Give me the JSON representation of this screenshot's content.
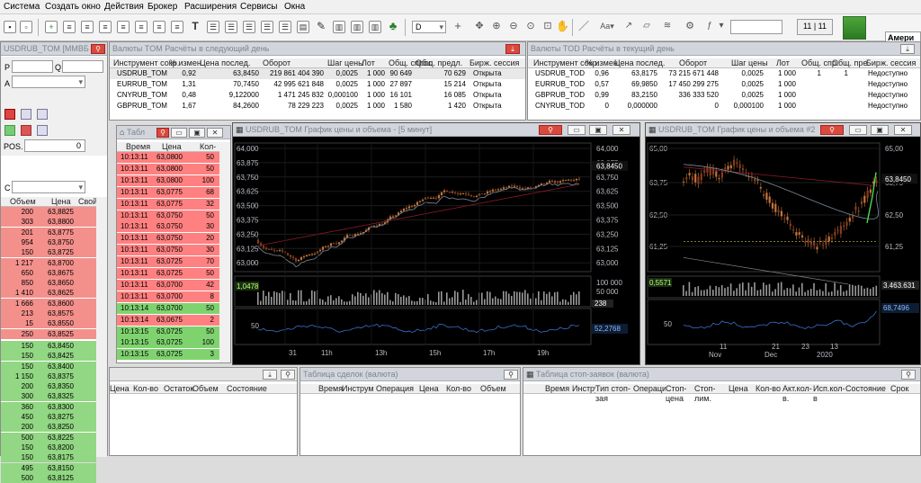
{
  "menu": [
    "Система",
    "Создать окно",
    "Действия",
    "Брокер",
    "Расширения",
    "Сервисы",
    "Окна"
  ],
  "toolbar": {
    "interval": "D",
    "page": "11 | 11",
    "news_label": "Амери\nте"
  },
  "left_panel": {
    "title": "USDRUB_TOM [ММВБ В",
    "p_label": "P",
    "q_label": "Q",
    "a_label": "A",
    "pos_label": "POS.",
    "pos_value": "0",
    "c_label": "C",
    "cols": [
      "Объем",
      "Цена",
      "Свой"
    ],
    "sell": [
      [
        "200",
        "63,8825"
      ],
      [
        "303",
        "63,8800"
      ],
      [
        "201",
        "63,8775"
      ],
      [
        "954",
        "63,8750"
      ],
      [
        "150",
        "63,8725"
      ],
      [
        "1 217",
        "63,8700"
      ],
      [
        "650",
        "63,8675"
      ],
      [
        "850",
        "63,8650"
      ],
      [
        "1 410",
        "63,8625"
      ],
      [
        "1 666",
        "63,8600"
      ],
      [
        "213",
        "63,8575"
      ],
      [
        "15",
        "63,8550"
      ],
      [
        "250",
        "63,8525"
      ]
    ],
    "buy": [
      [
        "150",
        "63,8450"
      ],
      [
        "150",
        "63,8425"
      ],
      [
        "150",
        "63,8400"
      ],
      [
        "1 150",
        "63,8375"
      ],
      [
        "200",
        "63,8350"
      ],
      [
        "300",
        "63,8325"
      ],
      [
        "360",
        "63,8300"
      ],
      [
        "450",
        "63,8275"
      ],
      [
        "200",
        "63,8250"
      ],
      [
        "500",
        "63,8225"
      ],
      [
        "150",
        "63,8200"
      ],
      [
        "150",
        "63,8175"
      ],
      [
        "495",
        "63,8150"
      ],
      [
        "500",
        "63,8125"
      ]
    ]
  },
  "tom_table": {
    "title": "Валюты TOM Расчёты в следующий день",
    "cols": [
      "Инструмент сокр.",
      "% измен.",
      "Цена послед.",
      "Оборот",
      "Шаг цены",
      "Лот",
      "Общ. спрос",
      "Общ. предл.",
      "Бирж. сессия"
    ],
    "rows": [
      [
        "USDRUB_TOM",
        "0,92",
        "63,8450",
        "219 861 404 390",
        "0,0025",
        "1 000",
        "90 649",
        "70 629",
        "Открыта"
      ],
      [
        "EURRUB_TOM",
        "1,31",
        "70,7450",
        "42 995 621 848",
        "0,0025",
        "1 000",
        "27 897",
        "15 214",
        "Открыта"
      ],
      [
        "CNYRUB_TOM",
        "0,48",
        "9,122000",
        "1 471 245 832",
        "0,000100",
        "1 000",
        "16 101",
        "16 085",
        "Открыта"
      ],
      [
        "GBPRUB_TOM",
        "1,67",
        "84,2600",
        "78 229 223",
        "0,0025",
        "1 000",
        "1 580",
        "1 420",
        "Открыта"
      ]
    ]
  },
  "tod_table": {
    "title": "Валюты TOD Расчёты в текущий день",
    "cols": [
      "Инструмент сокр.",
      "% измен.",
      "Цена послед.",
      "Оборот",
      "Шаг цены",
      "Лот",
      "Общ. спр.",
      "Общ. пре.",
      "Бирж. сессия"
    ],
    "rows": [
      [
        "USDRUB_TOD",
        "0,96",
        "63,8175",
        "73 215 671 448",
        "0,0025",
        "1 000",
        "1",
        "1",
        "Недоступно"
      ],
      [
        "EURRUB_TOD",
        "0,57",
        "69,9850",
        "17 450 299 275",
        "0,0025",
        "1 000",
        "",
        "",
        "Недоступно"
      ],
      [
        "GBPRUB_TOD",
        "0,99",
        "83,2150",
        "336 333 520",
        "0,0025",
        "1 000",
        "",
        "",
        "Недоступно"
      ],
      [
        "CNYRUB_TOD",
        "0",
        "0,000000",
        "0",
        "0,000100",
        "1 000",
        "",
        "",
        "Недоступно"
      ]
    ]
  },
  "trades": {
    "title": "Табл",
    "cols": [
      "Время",
      "Цена",
      "Кол-во"
    ],
    "rows": [
      [
        "10:13:11",
        "63,0800",
        "50",
        "s"
      ],
      [
        "10:13:11",
        "63,0800",
        "50",
        "s"
      ],
      [
        "10:13:11",
        "63,0800",
        "100",
        "s"
      ],
      [
        "10:13:11",
        "63,0775",
        "68",
        "s"
      ],
      [
        "10:13:11",
        "63,0775",
        "32",
        "s"
      ],
      [
        "10:13:11",
        "63,0750",
        "50",
        "s"
      ],
      [
        "10:13:11",
        "63,0750",
        "30",
        "s"
      ],
      [
        "10:13:11",
        "63,0750",
        "20",
        "s"
      ],
      [
        "10:13:11",
        "63,0750",
        "30",
        "s"
      ],
      [
        "10:13:11",
        "63,0725",
        "70",
        "s"
      ],
      [
        "10:13:11",
        "63,0725",
        "50",
        "s"
      ],
      [
        "10:13:11",
        "63,0700",
        "42",
        "s"
      ],
      [
        "10:13:11",
        "63,0700",
        "8",
        "s"
      ],
      [
        "10:13:14",
        "63,0700",
        "50",
        "b"
      ],
      [
        "10:13:14",
        "63,0675",
        "2",
        "s"
      ],
      [
        "10:13:15",
        "63,0725",
        "50",
        "b"
      ],
      [
        "10:13:15",
        "63,0725",
        "100",
        "b"
      ],
      [
        "10:13:15",
        "63,0725",
        "3",
        "b"
      ]
    ]
  },
  "chart1": {
    "title": "USDRUB_TOM График цены и объема - [5 минут]",
    "last": "63,8450",
    "vol_last": "1,0478",
    "osc_last": "52,2768",
    "osc_label": "50",
    "vol_ticks": [
      "100 000",
      "50 000",
      "238"
    ],
    "price_ticks": [
      "64,000",
      "63,875",
      "63,750",
      "63,625",
      "63,500",
      "63,375",
      "63,250",
      "63,125",
      "63,000"
    ],
    "x_ticks": [
      "31",
      "11h",
      "13h",
      "15h",
      "17h",
      "19h"
    ]
  },
  "chart2": {
    "title": "USDRUB_TOM График цены и объема #2",
    "last": "63,8450",
    "vol_last": "0,5571",
    "vol_right": "3.463.631",
    "osc_last": "68,7496",
    "osc_label": "50",
    "price_ticks": [
      "65,00",
      "63,75",
      "62,50",
      "61,25"
    ],
    "x_ticks": [
      "11",
      "Nov",
      "21",
      "Dec",
      "23",
      "2020",
      "13"
    ]
  },
  "bottom_left": {
    "cols": [
      "Цена",
      "Кол-во",
      "Остаток",
      "Объем",
      "Состояние"
    ]
  },
  "bottom_mid": {
    "title": "Таблица сделок (валюта)",
    "cols": [
      "Время",
      "Инструм",
      "Операция",
      "Цена",
      "Кол-во",
      "Объем"
    ]
  },
  "bottom_right": {
    "title": "Таблица стоп-заявок (валюта)",
    "cols": [
      "Время",
      "Инструм",
      "Тип стоп-зая",
      "Операция",
      "Стоп-цена",
      "Стоп-лим.",
      "Цена",
      "Кол-во",
      "Акт.кол-в.",
      "Исп.кол-в",
      "Состояние",
      "Срок"
    ]
  },
  "colors": {
    "sell": "#f4908c",
    "buy": "#92d783",
    "sell_row": "#ff8080",
    "buy_row": "#7fd36f",
    "chart_bg": "#000000",
    "candle_up": "#c4733a",
    "candle_down": "#8a3a1e"
  }
}
